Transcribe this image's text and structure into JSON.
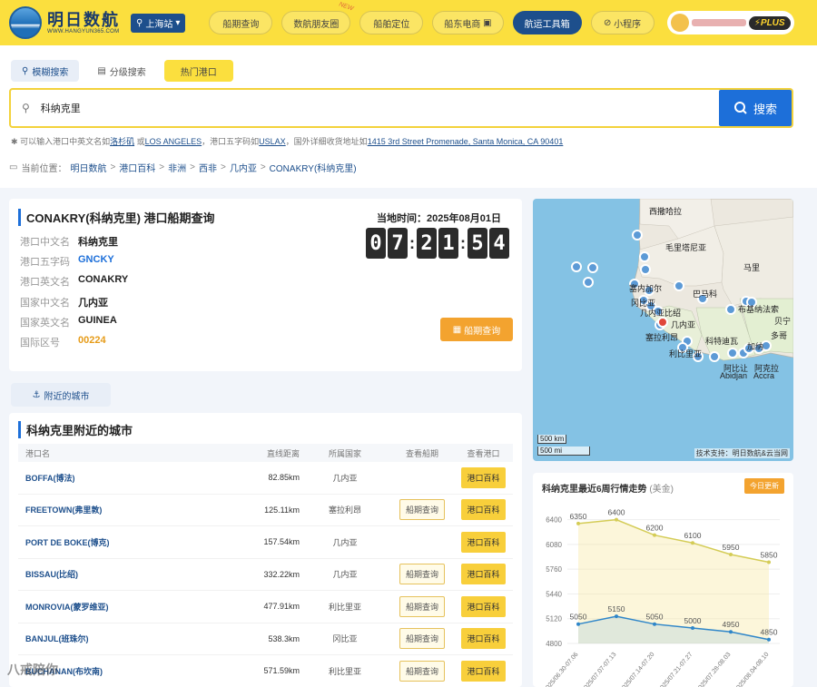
{
  "brand": {
    "name": "明日数航",
    "url": "WWW.HANGYUN365.COM",
    "station": "上海站"
  },
  "nav": {
    "items": [
      {
        "label": "船期查询"
      },
      {
        "label": "数航朋友圈",
        "badge": "NEW"
      },
      {
        "label": "船舶定位"
      },
      {
        "label": "船东电商"
      },
      {
        "label": "航运工具箱",
        "active": true
      },
      {
        "label": "小程序"
      }
    ],
    "plus_label": "PLUS"
  },
  "search": {
    "tabs": [
      "模糊搜索",
      "分级搜索",
      "热门港口"
    ],
    "value": "科纳克里",
    "button": "搜索",
    "hint_prefix": "可以输入港口中英文名如",
    "hint_ex1": "洛杉矶",
    "hint_or": " 或",
    "hint_ex2": "LOS ANGELES",
    "hint_mid": "，港口五字码如",
    "hint_ex3": "USLAX",
    "hint_mid2": "，国外详细收货地址如",
    "hint_ex4": "1415 3rd Street Promenade, Santa Monica, CA 90401"
  },
  "breadcrumb": {
    "label": "当前位置：",
    "items": [
      "明日数航",
      "港口百科",
      "非洲",
      "西非",
      "几内亚",
      "CONAKRY(科纳克里)"
    ]
  },
  "port": {
    "title": "CONAKRY(科纳克里) 港口船期查询",
    "fields": [
      {
        "label": "港口中文名",
        "value": "科纳克里",
        "style": ""
      },
      {
        "label": "港口五字码",
        "value": "GNCKY",
        "style": "blue"
      },
      {
        "label": "港口英文名",
        "value": "CONAKRY",
        "style": ""
      },
      {
        "label": "国家中文名",
        "value": "几内亚",
        "style": ""
      },
      {
        "label": "国家英文名",
        "value": "GUINEA",
        "style": ""
      },
      {
        "label": "国际区号",
        "value": "00224",
        "style": "orange"
      }
    ],
    "local_time_label": "当地时间：2025年08月01日",
    "clock": [
      "0",
      "7",
      "2",
      "1",
      "5",
      "4"
    ],
    "schedule_button": "船期查询"
  },
  "nearby_tab": "附近的城市",
  "cities": {
    "title": "科纳克里附近的城市",
    "headers": [
      "港口名",
      "直线距离",
      "所属国家",
      "查看船期",
      "查看港口"
    ],
    "sched_label": "船期查询",
    "wiki_label": "港口百科",
    "rows": [
      {
        "name": "BOFFA(博法)",
        "distance": "82.85km",
        "country": "几内亚",
        "has_schedule": false
      },
      {
        "name": "FREETOWN(弗里敦)",
        "distance": "125.11km",
        "country": "塞拉利昂",
        "has_schedule": true
      },
      {
        "name": "PORT DE BOKE(博克)",
        "distance": "157.54km",
        "country": "几内亚",
        "has_schedule": false
      },
      {
        "name": "BISSAU(比绍)",
        "distance": "332.22km",
        "country": "几内亚",
        "has_schedule": true
      },
      {
        "name": "MONROVIA(蒙罗维亚)",
        "distance": "477.91km",
        "country": "利比里亚",
        "has_schedule": true
      },
      {
        "name": "BANJUL(班珠尔)",
        "distance": "538.3km",
        "country": "冈比亚",
        "has_schedule": true
      },
      {
        "name": "BUCHANAN(布坎南)",
        "distance": "571.59km",
        "country": "利比里亚",
        "has_schedule": true
      }
    ]
  },
  "map": {
    "labels": [
      "西撒哈拉",
      "毛里塔尼亚",
      "马里",
      "塞内加尔",
      "巴马科",
      "冈比亚",
      "几内亚比绍",
      "布基纳法索",
      "几内亚",
      "塞拉利昂",
      "利比里亚",
      "科特迪瓦",
      "加纳",
      "多哥",
      "贝宁",
      "阿比让",
      "阿克拉",
      "Abidjan",
      "Accra"
    ],
    "scale": [
      "500 km",
      "500 mi"
    ],
    "credit": "技术支持：明日数航&云当网"
  },
  "trend": {
    "title": "科纳克里最近6周行情走势",
    "unit": "(美金)",
    "badge": "今日更新"
  },
  "chart_data": {
    "type": "area",
    "title": "科纳克里最近6周行情走势",
    "ylabel": "(美金)",
    "categories": [
      "2025/06.30-07.06",
      "2025/07.07-07.13",
      "2025/07.14-07.20",
      "2025/07.21-07.27",
      "2025/07.28-08.03",
      "2025/08.04-08.10"
    ],
    "yticks": [
      4800,
      5120,
      5440,
      5760,
      6080,
      6400
    ],
    "ylim": [
      4800,
      6560
    ],
    "series": [
      {
        "values": [
          6350,
          6400,
          6200,
          6100,
          5950,
          5850
        ],
        "color": "#d4cc56"
      },
      {
        "values": [
          5050,
          5150,
          5050,
          5000,
          4950,
          4850
        ],
        "color": "#2f86c9"
      }
    ]
  },
  "watermark": "八戒陪你"
}
